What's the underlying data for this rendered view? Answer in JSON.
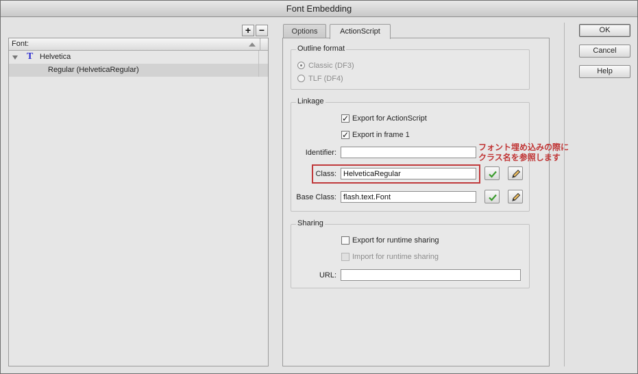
{
  "window": {
    "title": "Font Embedding"
  },
  "font_panel": {
    "add_label": "+",
    "remove_label": "−",
    "header_label": "Font:",
    "family": "Helvetica",
    "style_item": "Regular (HelveticaRegular)"
  },
  "tabs": [
    {
      "label": "Options",
      "active": false
    },
    {
      "label": "ActionScript",
      "active": true
    }
  ],
  "outline_format": {
    "title": "Outline format",
    "options": [
      {
        "label": "Classic (DF3)",
        "selected": true,
        "enabled": false
      },
      {
        "label": "TLF (DF4)",
        "selected": false,
        "enabled": false
      }
    ]
  },
  "linkage": {
    "title": "Linkage",
    "export_actionscript": {
      "label": "Export for ActionScript",
      "checked": true
    },
    "export_frame1": {
      "label": "Export in frame 1",
      "checked": true
    },
    "identifier": {
      "label": "Identifier:",
      "value": ""
    },
    "class": {
      "label": "Class:",
      "value": "HelveticaRegular"
    },
    "base_class": {
      "label": "Base Class:",
      "value": "flash.text.Font"
    }
  },
  "sharing": {
    "title": "Sharing",
    "export_runtime": {
      "label": "Export for runtime sharing",
      "checked": false
    },
    "import_runtime": {
      "label": "Import for runtime sharing",
      "checked": false,
      "enabled": false
    },
    "url": {
      "label": "URL:",
      "value": ""
    }
  },
  "annotation": {
    "line1": "フォント埋め込みの際に",
    "line2": "クラス名を参照します",
    "color": "#c03535"
  },
  "buttons": {
    "ok": "OK",
    "cancel": "Cancel",
    "help": "Help"
  }
}
